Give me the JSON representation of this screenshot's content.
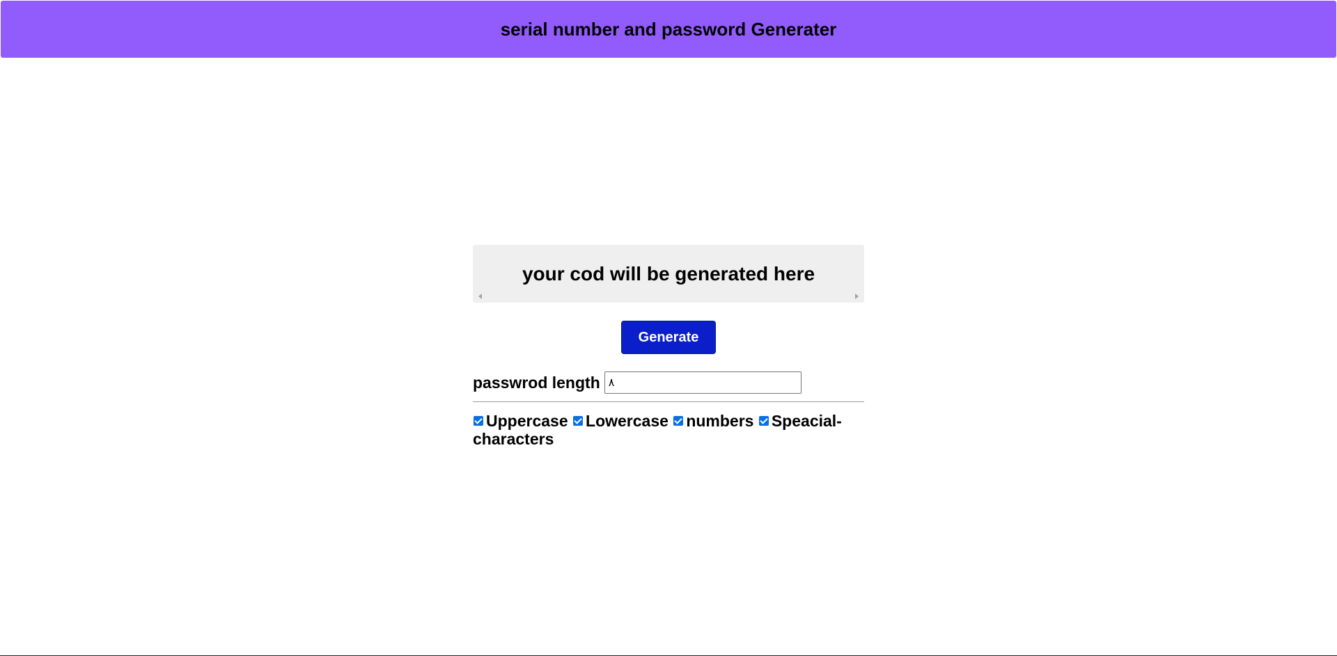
{
  "header": {
    "title": "serial number and password Generater"
  },
  "output": {
    "text": "your cod will be generated here"
  },
  "generate_button": {
    "label": "Generate"
  },
  "length": {
    "label": "passwrod length",
    "value": "٨"
  },
  "options": [
    {
      "label": "Uppercase",
      "checked": true
    },
    {
      "label": "Lowercase",
      "checked": true
    },
    {
      "label": "numbers",
      "checked": true
    },
    {
      "label": "Speacial-characters",
      "checked": true
    }
  ],
  "colors": {
    "header_bg": "#915cfb",
    "button_bg": "#0a1fc9",
    "output_bg": "#efefef",
    "checkbox": "#0a6fe0"
  },
  "icons": {
    "scroll_left": "scroll-left-arrow-icon",
    "scroll_right": "scroll-right-arrow-icon",
    "checkbox": "checkmark-icon"
  }
}
